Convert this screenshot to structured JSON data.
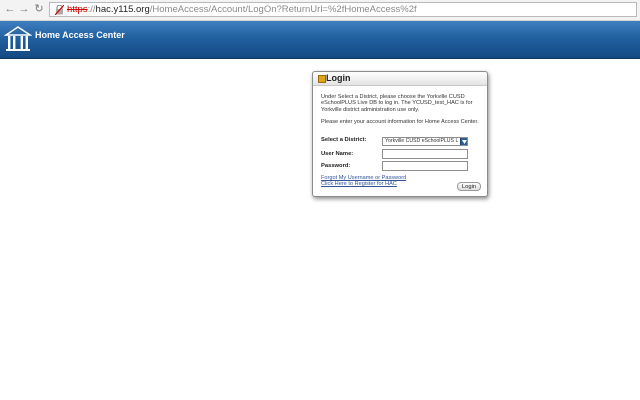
{
  "browser": {
    "back_glyph": "←",
    "forward_glyph": "→",
    "reload_glyph": "↻",
    "url_scheme": "https",
    "url_sep": "://",
    "url_host": "hac.y115.org",
    "url_path": "/HomeAccess/Account/LogOn?ReturnUrl=%2fHomeAccess%2f"
  },
  "header": {
    "title": "Home Access Center",
    "logo_icon": "building-icon",
    "colors": {
      "top": "#3f7fc0",
      "bottom": "#144a83"
    }
  },
  "login": {
    "title": "Login",
    "instructions": "Under Select a District, please choose the Yorkville CUSD eSchoolPLUS Live DB to log in. The YCUSD_test_HAC is for Yorkville district administration use only.",
    "prompt": "Please enter your account information for Home Access Center.",
    "district_label": "Select a District:",
    "district_value": "Yorkville CUSD eSchoolPLUS L",
    "username_label": "User Name:",
    "password_label": "Password:",
    "forgot_link": "Forgot My Username or Password",
    "register_link": "Click Here to Register for HAC",
    "button_label": "Login"
  }
}
